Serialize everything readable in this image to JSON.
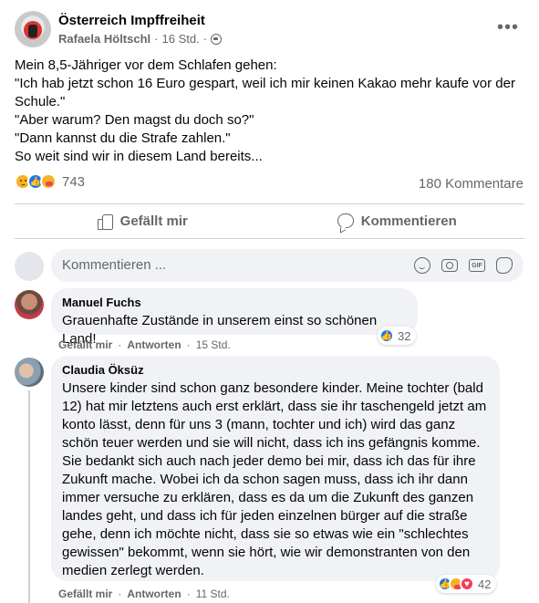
{
  "post": {
    "group_name": "Österreich Impffreiheit",
    "author": "Rafaela Höltschl",
    "time": "16 Std.",
    "separator": "·",
    "more_icon": "more-horizontal-icon",
    "privacy_icon": "globe-icon",
    "lines": [
      "Mein 8,5-Jähriger vor dem Schlafen gehen:",
      "\"Ich hab jetzt schon 16 Euro gespart, weil ich mir keinen Kakao mehr kaufe vor der Schule.\"",
      "\"Aber warum? Den magst du doch so?\"",
      "\"Dann kannst du die Strafe zahlen.\"",
      "So weit sind wir in diesem Land bereits..."
    ],
    "reaction_count": "743",
    "reaction_icons": [
      "sad-reaction-icon",
      "like-reaction-icon",
      "care-reaction-icon"
    ],
    "comment_count": "180 Kommentare"
  },
  "actions": {
    "like_label": "Gefällt mir",
    "comment_label": "Kommentieren"
  },
  "composer": {
    "placeholder": "Kommentieren ...",
    "icons": [
      "emoji-icon",
      "camera-icon",
      "gif-icon",
      "sticker-icon"
    ]
  },
  "comments": [
    {
      "author": "Manuel Fuchs",
      "text": "Grauenhafte Zustände in unserem einst so schönen Land!",
      "like_label": "Gefällt mir",
      "reply_label": "Antworten",
      "time": "15 Std.",
      "reaction_count": "32",
      "reaction_icons": [
        "like-reaction-icon"
      ]
    },
    {
      "author": "Claudia Öksüz",
      "text": "Unsere kinder sind schon ganz besondere kinder. Meine tochter (bald 12) hat mir letztens auch erst erklärt, dass sie ihr taschengeld jetzt am konto lässt, denn für uns 3 (mann, tochter und ich) wird das ganz schön teuer werden und sie will nicht, dass ich ins gefängnis komme. Sie bedankt sich auch nach jeder demo bei mir, dass ich das für ihre Zukunft mache. Wobei ich da schon sagen muss, dass ich ihr dann immer versuche zu erklären, dass es da um die Zukunft des ganzen landes geht, und dass ich für jeden einzelnen bürger auf die straße gehe, denn ich möchte nicht, dass sie so etwas wie ein \"schlechtes gewissen\" bekommt, wenn sie hört, wie wir demonstranten von den medien zerlegt werden.",
      "like_label": "Gefällt mir",
      "reply_label": "Antworten",
      "time": "11 Std.",
      "reaction_count": "42",
      "reaction_icons": [
        "like-reaction-icon",
        "care-reaction-icon",
        "love-reaction-icon"
      ]
    }
  ],
  "colors": {
    "text": "#050505",
    "secondary": "#65676b",
    "bubble": "#f0f2f5",
    "like_blue": "#1877f2",
    "love_red": "#f33e58",
    "emoji_yellow": "#f7b125"
  }
}
